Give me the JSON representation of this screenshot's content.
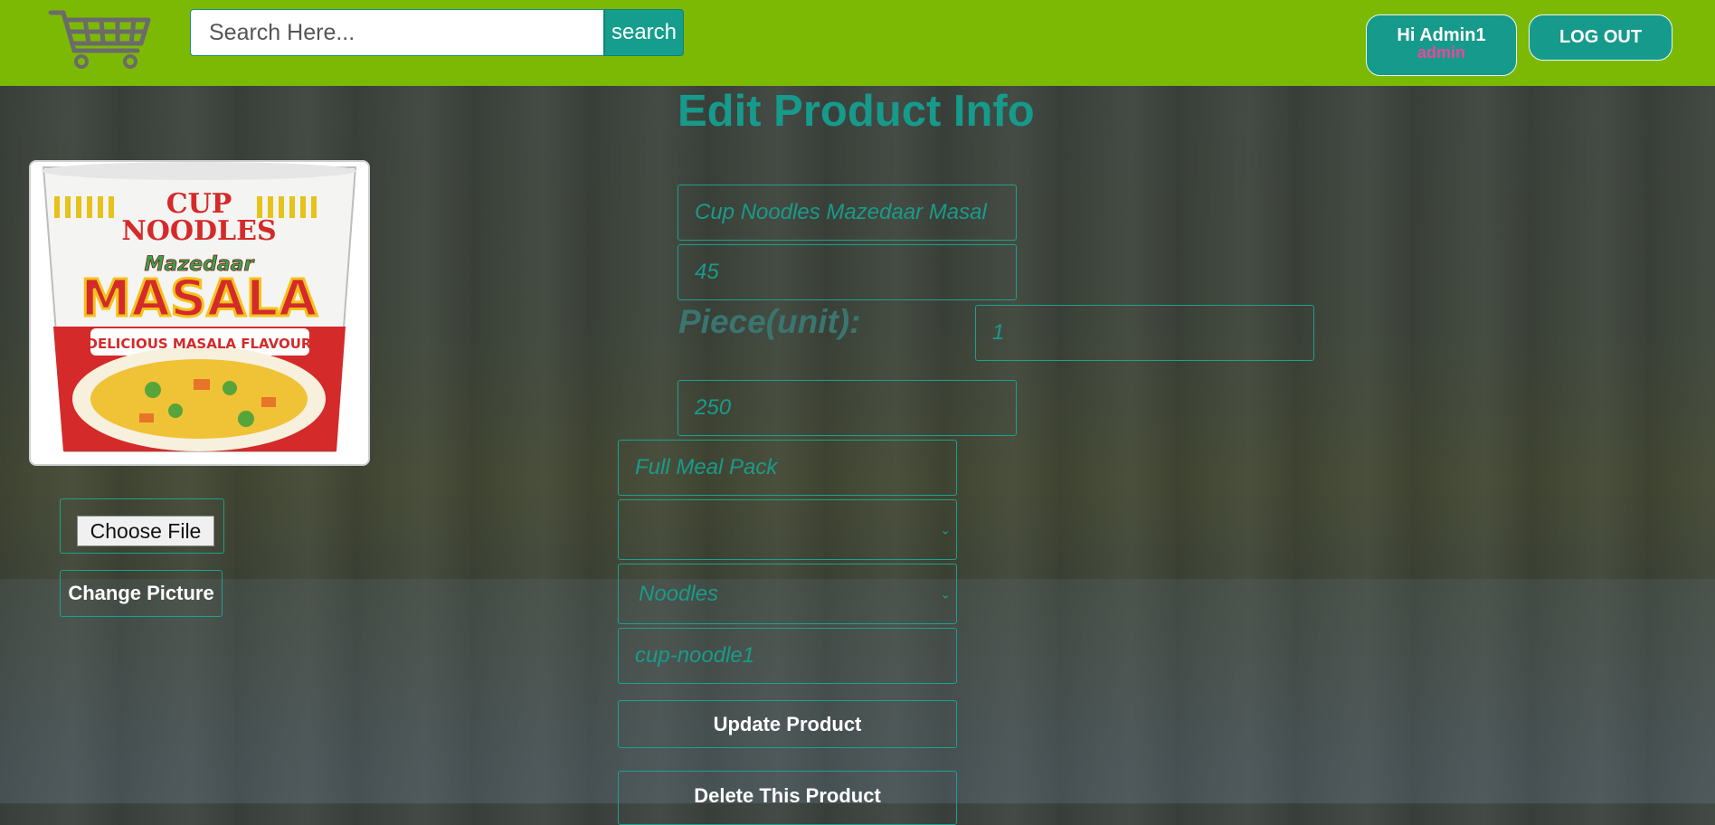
{
  "header": {
    "logo_icon": "shopping-cart-icon",
    "search": {
      "placeholder": "Search Here...",
      "value": ""
    },
    "search_button": "search",
    "user_greeting": "Hi Admin1",
    "user_role": "admin",
    "logout": "LOG OUT",
    "bar_color": "#7cb904",
    "accent_color": "#169a8b"
  },
  "page_title": "Edit Product Info",
  "product_image": {
    "brand_line1": "CUP",
    "brand_line2": "NOODLES",
    "variant_script": "Mazedaar",
    "variant": "MASALA",
    "tagline": "DELICIOUS MASALA FLAVOUR"
  },
  "form": {
    "name": "Cup Noodles Mazedaar Masal",
    "price": "45",
    "unit_label": "Piece(unit):",
    "unit_value": "1",
    "weight": "250",
    "description": "Full Meal Pack",
    "select_empty": "",
    "category": "Noodles",
    "slug": "cup-noodle1"
  },
  "picture": {
    "choose_file": "Choose File",
    "change_picture": "Change Picture"
  },
  "actions": {
    "update": "Update Product",
    "delete": "Delete This Product"
  }
}
